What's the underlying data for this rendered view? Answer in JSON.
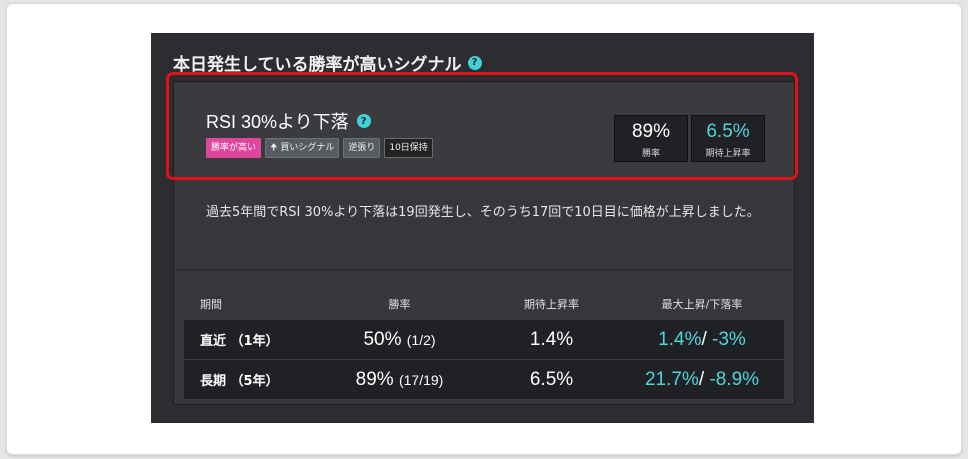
{
  "panel": {
    "title": "本日発生している勝率が高いシグナル",
    "help_icon": "?"
  },
  "signal": {
    "name": "RSI 30%より下落",
    "help_icon": "?",
    "tags": [
      {
        "label": "勝率が高い",
        "style": "pink"
      },
      {
        "label": "🠉 買いシグナル",
        "style": "grey"
      },
      {
        "label": "逆張り",
        "style": "grey"
      },
      {
        "label": "10日保持",
        "style": "dark"
      }
    ],
    "win_rate": {
      "value": "89%",
      "label": "勝率"
    },
    "expected_rise": {
      "value": "6.5%",
      "label": "期待上昇率"
    }
  },
  "summary": "過去5年間でRSI 30%より下落は19回発生し、そのうち17回で10日目に価格が上昇しました。",
  "table": {
    "headers": [
      "期間",
      "勝率",
      "期待上昇率",
      "最大上昇/下落率"
    ],
    "rows": [
      {
        "period": "直近 （1年）",
        "win_rate": "50%",
        "win_count": "(1/2)",
        "expected": "1.4%",
        "max_up": "1.4%",
        "max_down": "-3%"
      },
      {
        "period": "長期 （5年）",
        "win_rate": "89%",
        "win_count": "(17/19)",
        "expected": "6.5%",
        "max_up": "21.7%",
        "max_down": "-8.9%"
      }
    ]
  },
  "colors": {
    "panel_bg": "#2b2d30",
    "accent_cyan": "#4fd4dc",
    "highlight_red": "#e3101c",
    "tag_pink": "#e0469b"
  }
}
